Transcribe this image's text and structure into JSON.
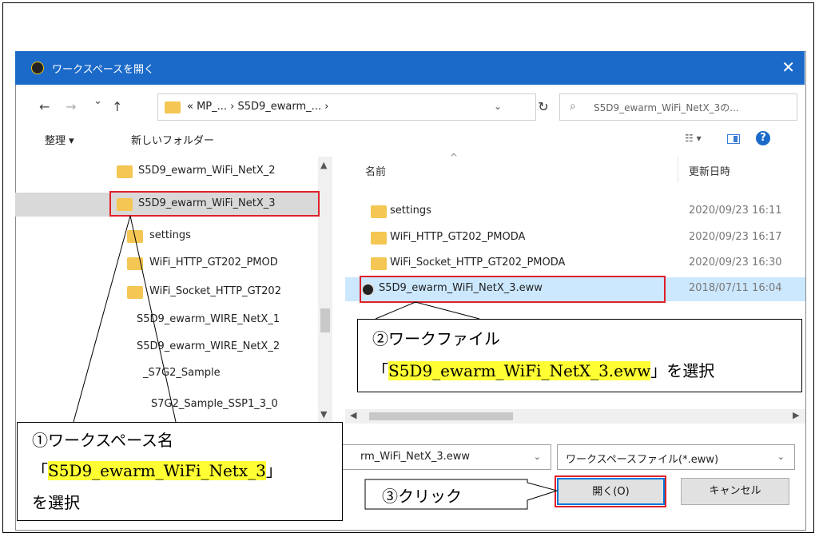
{
  "dialog": {
    "title": "ワークスペースを開く",
    "close_glyph": "✕"
  },
  "nav": {
    "back": "←",
    "forward": "→",
    "recent": "⌄",
    "up": "↑",
    "address": "« MP_... › S5D9_ewarm_... ›",
    "address_dropdown": "⌄",
    "refresh": "↻",
    "search_placeholder": "S5D9_ewarm_WiFi_NetX_3の...",
    "search_icon": "⌕"
  },
  "toolbar": {
    "organize": "整理 ▾",
    "new_folder": "新しいフォルダー",
    "view_icon": "☷ ▾",
    "help": "?"
  },
  "tree": {
    "items": [
      {
        "label": "S5D9_ewarm_WiFi_NetX_2"
      },
      {
        "label": "S5D9_ewarm_WiFi_NetX_3"
      },
      {
        "label": "settings"
      },
      {
        "label": "WiFi_HTTP_GT202_PMOD"
      },
      {
        "label": "WiFi_Socket_HTTP_GT202"
      },
      {
        "label": "S5D9_ewarm_WIRE_NetX_1"
      },
      {
        "label": "S5D9_ewarm_WIRE_NetX_2"
      },
      {
        "label": "_S7G2_Sample"
      },
      {
        "label": "S7G2_Sample_SSP1_3_0"
      }
    ]
  },
  "files": {
    "col_name": "名前",
    "col_date": "更新日時",
    "sort_caret": "^",
    "rows": [
      {
        "name": "settings",
        "date": "2020/09/23 16:11"
      },
      {
        "name": "WiFi_HTTP_GT202_PMODA",
        "date": "2020/09/23 16:17"
      },
      {
        "name": "WiFi_Socket_HTTP_GT202_PMODA",
        "date": "2020/09/23 16:30"
      },
      {
        "name": "S5D9_ewarm_WiFi_NetX_3.eww",
        "date": "2018/07/11 16:04"
      }
    ]
  },
  "footer": {
    "filename_value": "rm_WiFi_NetX_3.eww",
    "filetype_value": "ワークスペースファイル(*.eww)",
    "open_button": "開く(O)",
    "cancel_button": "キャンセル",
    "dropdown_glyph": "⌄"
  },
  "callouts": {
    "workfile": {
      "line1": "②ワークファイル",
      "line2_pre": "「",
      "line2_hl": "S5D9_ewarm_WiFi_NetX_3.eww",
      "line2_post": "」を選択"
    },
    "workspace": {
      "line1": "①ワークスペース名",
      "line2_pre": "「",
      "line2_hl": "S5D9_ewarm_WiFi_Netx_3",
      "line2_post": "」",
      "line3": "を選択"
    },
    "click": {
      "line1": "③クリック"
    }
  },
  "colors": {
    "title_bar": "#1b6ac9",
    "annotation_red": "#e0202a",
    "highlight": "#ffff33",
    "selection": "#cce8ff"
  }
}
